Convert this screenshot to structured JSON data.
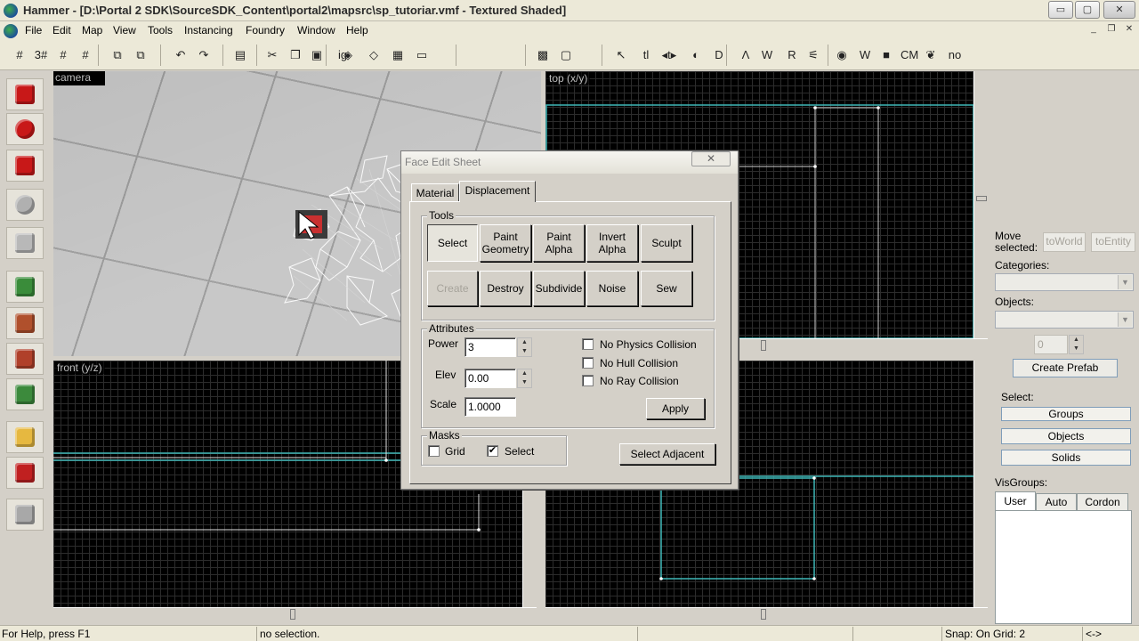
{
  "window": {
    "title": "Hammer - [D:\\Portal 2 SDK\\SourceSDK_Content\\portal2\\mapsrc\\sp_tutoriar.vmf - Textured Shaded]",
    "min_glyph": "▭",
    "max_glyph": "▢",
    "close_glyph": "✕"
  },
  "menubar": {
    "items": [
      "File",
      "Edit",
      "Map",
      "View",
      "Tools",
      "Instancing",
      "Foundry",
      "Window",
      "Help"
    ],
    "doc_min_glyph": "_",
    "doc_restore_glyph": "❐",
    "doc_close_glyph": "✕"
  },
  "toolbar": {
    "buttons": [
      {
        "name": "grid-toggle-icon",
        "glyph": "#"
      },
      {
        "name": "grid-3d-icon",
        "glyph": "3#"
      },
      {
        "name": "grid-smaller-icon",
        "glyph": "#"
      },
      {
        "name": "grid-larger-icon",
        "glyph": "#"
      },
      {
        "name": "group-icon",
        "glyph": "⧉"
      },
      {
        "name": "ungroup-icon",
        "glyph": "⧉"
      },
      {
        "name": "undo-icon",
        "glyph": "↶"
      },
      {
        "name": "redo-icon",
        "glyph": "↷"
      },
      {
        "name": "carve-icon",
        "glyph": "▤"
      },
      {
        "name": "cut-icon",
        "glyph": "✂"
      },
      {
        "name": "copy-icon",
        "glyph": "❐"
      },
      {
        "name": "paste-icon",
        "glyph": "▣"
      },
      {
        "name": "ignore-groups-icon",
        "glyph": "ig"
      },
      {
        "name": "hide-items-icon",
        "glyph": "◈"
      },
      {
        "name": "show-items-icon",
        "glyph": "◇"
      },
      {
        "name": "texture-lock-icon",
        "glyph": "▦"
      },
      {
        "name": "brush-icon",
        "glyph": "▭"
      },
      {
        "name": "helpers-toggle-icon",
        "glyph": "▩"
      },
      {
        "name": "selection-box-icon",
        "glyph": "▢"
      },
      {
        "name": "select-cursor-icon",
        "glyph": "↖"
      },
      {
        "name": "texture-lock-text-icon",
        "glyph": "tl"
      },
      {
        "name": "scale-texture-icon",
        "glyph": "◂t▸"
      },
      {
        "name": "flip-icon",
        "glyph": "◐"
      },
      {
        "name": "entity-report-icon",
        "glyph": "D"
      },
      {
        "name": "vertex-tool-icon",
        "glyph": "Λ"
      },
      {
        "name": "check-problems-icon",
        "glyph": "W"
      },
      {
        "name": "run-map-icon",
        "glyph": "R"
      },
      {
        "name": "cordon-icon",
        "glyph": "⚟"
      },
      {
        "name": "sphere-icon",
        "glyph": "◉"
      },
      {
        "name": "wireframe-icon",
        "glyph": "W"
      },
      {
        "name": "blue-cube-icon",
        "glyph": "■"
      },
      {
        "name": "cm-text-icon",
        "glyph": "CM"
      },
      {
        "name": "leaf-icon",
        "glyph": "❦"
      },
      {
        "name": "no-draw-icon",
        "glyph": "no"
      }
    ]
  },
  "palette": {
    "tools": [
      {
        "name": "selection-tool-icon",
        "color": "#c81818"
      },
      {
        "name": "magnify-tool-icon",
        "color": "#c81818"
      },
      {
        "name": "camera-tool-icon",
        "color": "#c81818"
      },
      {
        "name": "entity-tool-icon",
        "color": "#b0b0b0"
      },
      {
        "name": "block-tool-icon",
        "color": "#b8b8b8"
      },
      {
        "name": "texture-application-icon",
        "color": "#3a8c3a"
      },
      {
        "name": "apply-texture-icon",
        "color": "#b0502c"
      },
      {
        "name": "decal-tool-icon",
        "color": "#b0402a"
      },
      {
        "name": "overlay-tool-icon",
        "color": "#3c8a3c"
      },
      {
        "name": "clipping-tool-icon",
        "color": "#e6b840"
      },
      {
        "name": "vertex-tool-icon",
        "color": "#c02020"
      },
      {
        "name": "path-tool-icon",
        "color": "#a8a8a8"
      }
    ]
  },
  "viewports": {
    "camera": "camera",
    "top": "top (x/y)",
    "front": "front (y/z)"
  },
  "face_edit": {
    "title": "Face Edit Sheet",
    "close_glyph": "✕",
    "tabs": [
      "Material",
      "Displacement"
    ],
    "tools_label": "Tools",
    "tools_row1": [
      "Select",
      "Paint\nGeometry",
      "Paint\nAlpha",
      "Invert\nAlpha",
      "Sculpt"
    ],
    "tools_row2": [
      "Create",
      "Destroy",
      "Subdivide",
      "Noise",
      "Sew"
    ],
    "attributes_label": "Attributes",
    "power_label": "Power",
    "power_value": "3",
    "elev_label": "Elev",
    "elev_value": "0.00",
    "scale_label": "Scale",
    "scale_value": "1.0000",
    "checks": [
      "No Physics Collision",
      "No Hull Collision",
      "No Ray Collision"
    ],
    "apply": "Apply",
    "masks_label": "Masks",
    "grid_label": "Grid",
    "select_label": "Select",
    "select_checked": "✔",
    "select_adjacent": "Select Adjacent"
  },
  "right_panel": {
    "move_label": "Move\nselected:",
    "to_world": "toWorld",
    "to_entity": "toEntity",
    "categories_label": "Categories:",
    "objects_label": "Objects:",
    "prefab_count": "0",
    "create_prefab": "Create Prefab",
    "select_label": "Select:",
    "groups": "Groups",
    "objects_btn": "Objects",
    "solids": "Solids",
    "visgroups_label": "VisGroups:",
    "vis_tabs": [
      "User",
      "Auto",
      "Cordon"
    ]
  },
  "status": {
    "help": "For Help, press F1",
    "selection": "no selection.",
    "snap": "Snap: On Grid: 2",
    "arrows": "<->"
  }
}
